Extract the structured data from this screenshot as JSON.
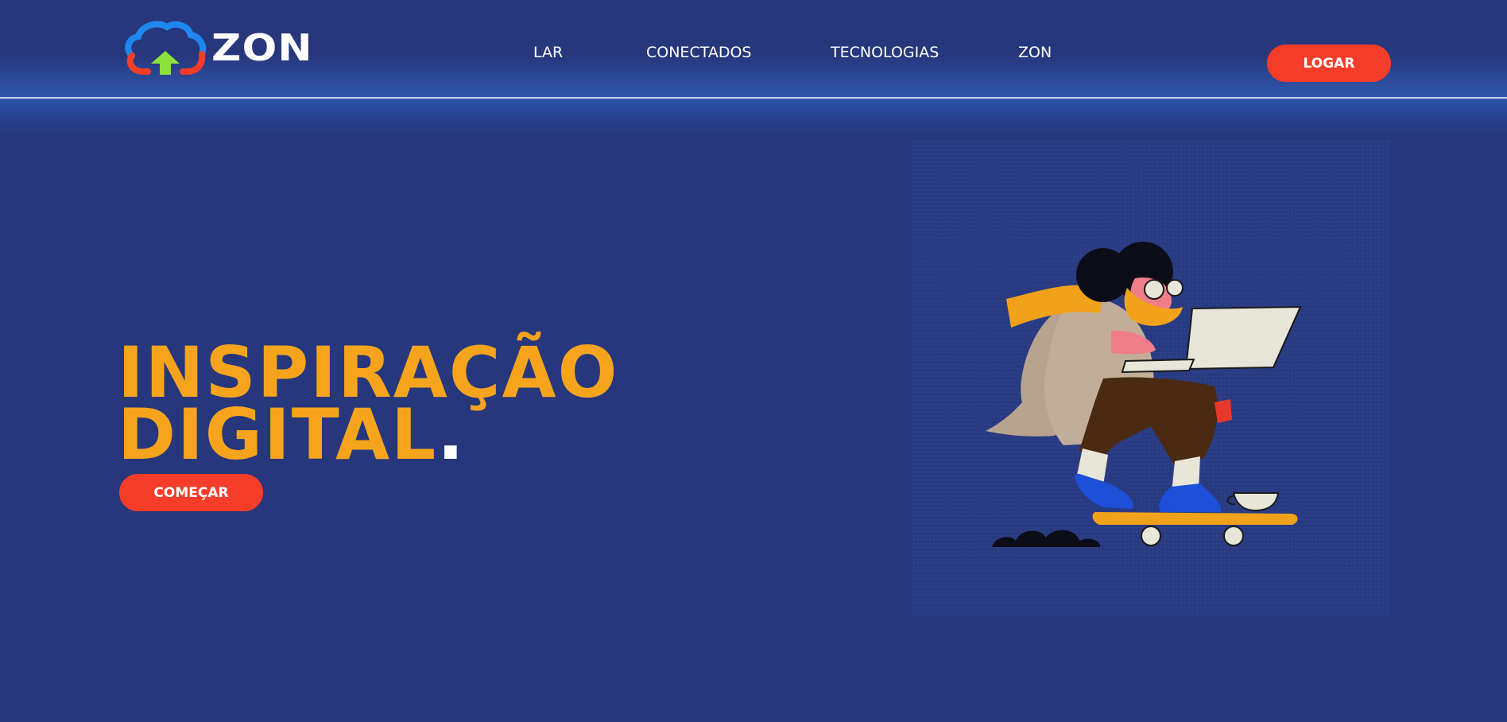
{
  "brand": {
    "name": "ZON",
    "logo_icon": "cloud-upload-icon",
    "colors": {
      "cloud_blue": "#1e88f0",
      "cloud_red": "#f53d2a",
      "arrow_green": "#8be23a"
    }
  },
  "nav": {
    "items": [
      {
        "label": "LAR"
      },
      {
        "label": "CONECTADOS"
      },
      {
        "label": "TECNOLOGIAS"
      },
      {
        "label": "ZON"
      }
    ],
    "login_label": "LOGAR"
  },
  "hero": {
    "title_line1": "INSPIRAÇÃO",
    "title_line2": "DIGITAL",
    "title_dot": ".",
    "cta_label": "COMEÇAR",
    "illustration": "person-on-skateboard-with-laptop"
  },
  "colors": {
    "background": "#27377c",
    "accent_orange": "#f7a41d",
    "button_red": "#f53d2a",
    "text_white": "#ffffff"
  }
}
